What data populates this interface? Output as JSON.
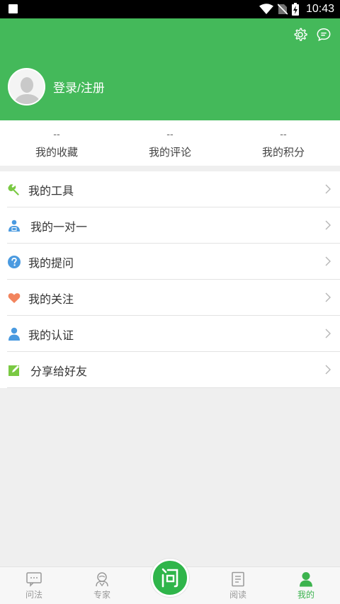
{
  "status_bar": {
    "time": "10:43"
  },
  "header": {
    "login_label": "登录/注册",
    "bg_color": "#44b95a"
  },
  "stats": [
    {
      "value": "--",
      "label": "我的收藏"
    },
    {
      "value": "--",
      "label": "我的评论"
    },
    {
      "value": "--",
      "label": "我的积分"
    }
  ],
  "menu": [
    {
      "label": "我的工具",
      "icon": "wrench-icon"
    },
    {
      "label": "我的一对一",
      "icon": "consultant-icon"
    },
    {
      "label": "我的提问",
      "icon": "question-icon"
    },
    {
      "label": "我的关注",
      "icon": "heart-icon"
    },
    {
      "label": "我的认证",
      "icon": "user-verify-icon"
    },
    {
      "label": "分享给好友",
      "icon": "share-edit-icon"
    }
  ],
  "bottom_nav": {
    "items": [
      {
        "label": "问法",
        "icon": "chat-icon"
      },
      {
        "label": "专家",
        "icon": "expert-icon"
      },
      {
        "label": "阅读",
        "icon": "document-icon"
      },
      {
        "label": "我的",
        "icon": "person-icon"
      }
    ],
    "center_label": "问",
    "active": "我的",
    "active_color": "#3cb34e"
  }
}
